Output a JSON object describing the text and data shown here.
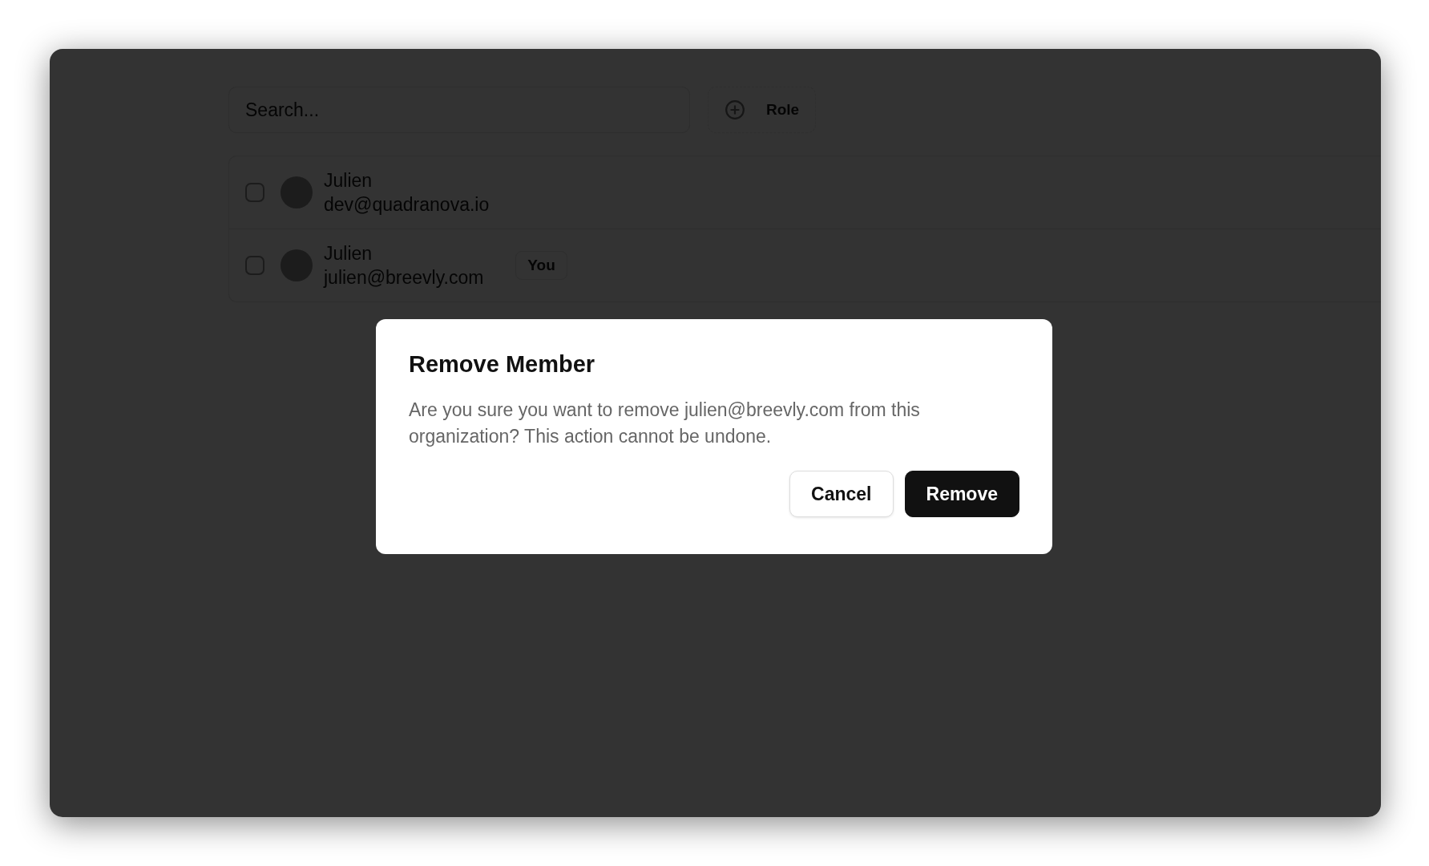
{
  "toolbar": {
    "search": {
      "placeholder": "Search..."
    },
    "filter_button": {
      "label": "Role"
    }
  },
  "members": [
    {
      "name": "Julien",
      "email": "dev@quadranova.io",
      "checked": false
    },
    {
      "name": "Julien",
      "email": "julien@breevly.com",
      "checked": false,
      "badge": "You"
    }
  ],
  "dialog": {
    "title": "Remove Member",
    "message": "Are you sure you want to remove julien@breevly.com from this organization? This action cannot be undone.",
    "buttons": [
      {
        "label": "Cancel",
        "kind": "secondary"
      },
      {
        "label": "Remove",
        "kind": "primary"
      }
    ]
  }
}
